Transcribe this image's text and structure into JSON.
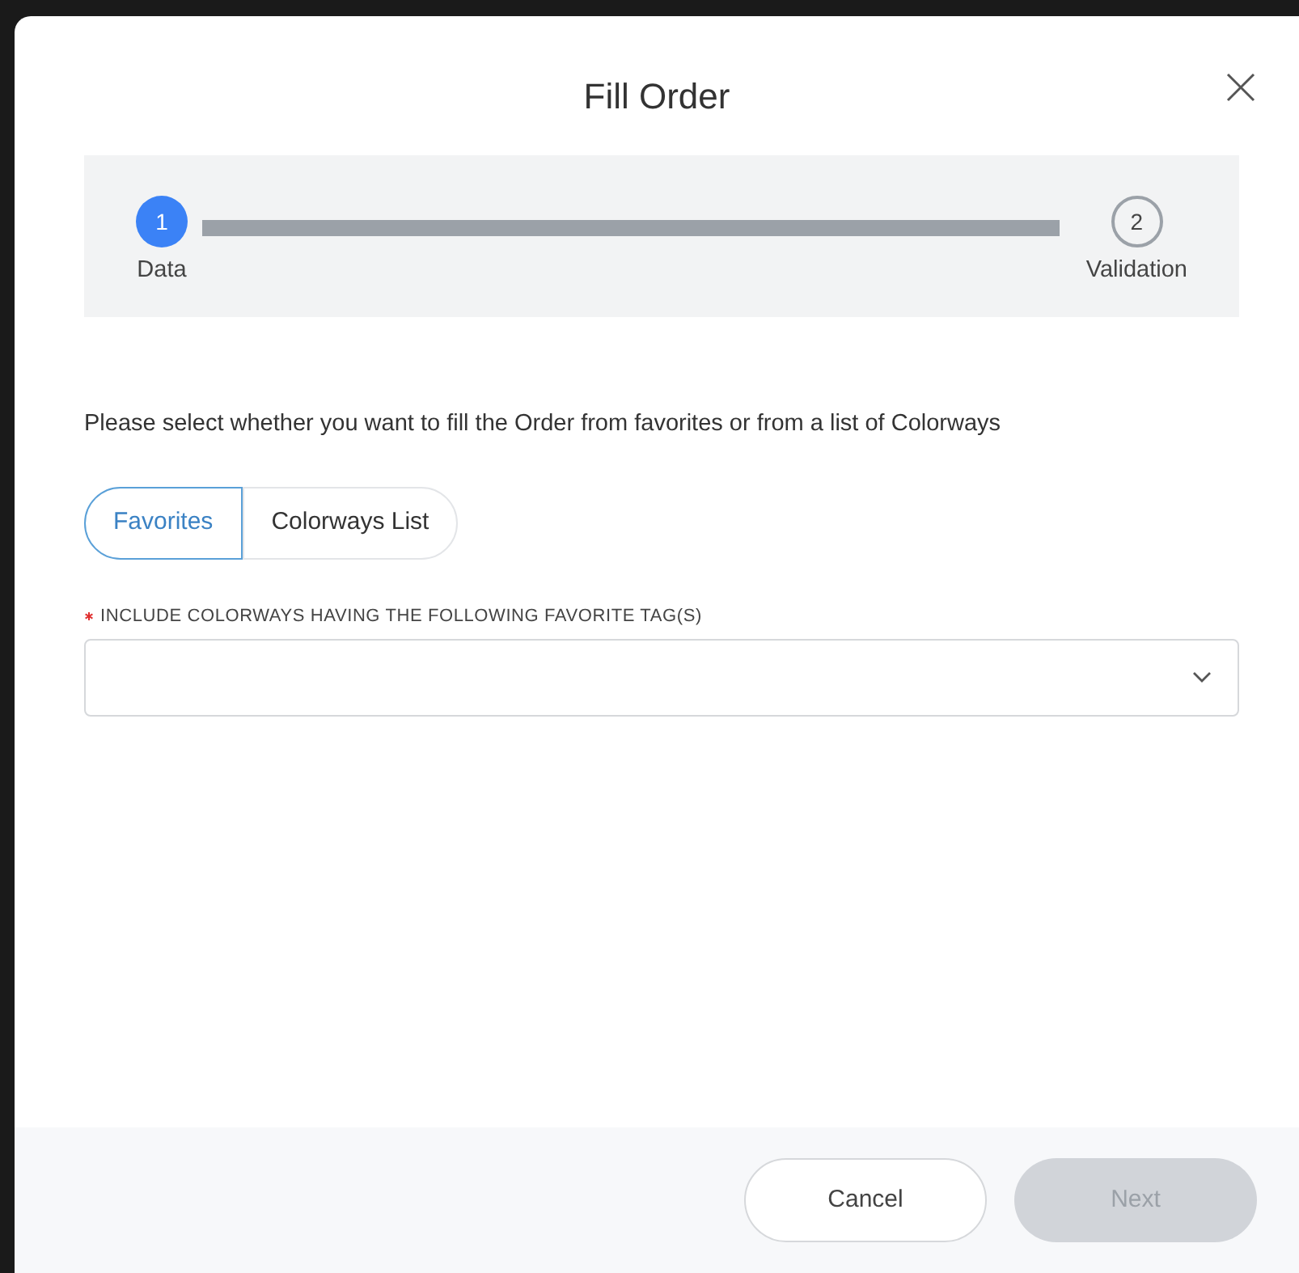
{
  "dialog": {
    "title": "Fill Order"
  },
  "steps": [
    {
      "number": "1",
      "label": "Data",
      "selected": true
    },
    {
      "number": "2",
      "label": "Validation",
      "selected": false
    }
  ],
  "instructions": "Please select whether you want to fill the Order from favorites or from a list of Colorways",
  "source_toggle": [
    {
      "label": "Favorites",
      "selected": true
    },
    {
      "label": "Colorways List",
      "selected": false
    }
  ],
  "tags_field": {
    "label": "INCLUDE COLORWAYS HAVING THE FOLLOWING FAVORITE TAG(S)",
    "required": true
  },
  "buttons": [
    {
      "label": "Cancel",
      "kind": "secondary",
      "disabled": false
    },
    {
      "label": "Next",
      "kind": "primary",
      "disabled": true
    }
  ]
}
